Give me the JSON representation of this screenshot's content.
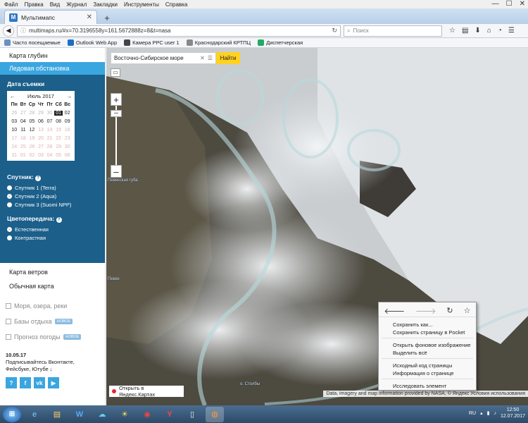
{
  "menu": [
    "Файл",
    "Правка",
    "Вид",
    "Журнал",
    "Закладки",
    "Инструменты",
    "Справка"
  ],
  "tab": {
    "title": "Мультимапс",
    "favicon": "M"
  },
  "url": "multimaps.ru/#x=70.3196558y=161.5672888z=8&t=nasa",
  "search_placeholder": "Поиск",
  "bookmarks": [
    "Часто посещаемые",
    "Outlook Web App",
    "Камера РРС user 1",
    "Краснодарский КРТПЦ",
    "Диспетчерская"
  ],
  "sidebar": {
    "depth_map": "Карта глубин",
    "ice": "Ледовая обстановка",
    "date_label": "Дата съемки",
    "calendar": {
      "month": "Июль 2017",
      "dow": [
        "Пн",
        "Вт",
        "Ср",
        "Чт",
        "Пт",
        "Сб",
        "Вс"
      ],
      "days": [
        [
          "26",
          "dim"
        ],
        [
          "27",
          "dim"
        ],
        [
          "28",
          "dim"
        ],
        [
          "29",
          "dim"
        ],
        [
          "30",
          "dim"
        ],
        [
          "01",
          "sel"
        ],
        [
          "02",
          ""
        ],
        [
          "03",
          ""
        ],
        [
          "04",
          ""
        ],
        [
          "05",
          ""
        ],
        [
          "06",
          ""
        ],
        [
          "07",
          ""
        ],
        [
          "08",
          ""
        ],
        [
          "09",
          ""
        ],
        [
          "10",
          ""
        ],
        [
          "11",
          ""
        ],
        [
          "12",
          ""
        ],
        [
          "13",
          "disabled"
        ],
        [
          "14",
          "disabled"
        ],
        [
          "15",
          "disabled"
        ],
        [
          "16",
          "disabled"
        ],
        [
          "17",
          "disabled"
        ],
        [
          "18",
          "disabled"
        ],
        [
          "19",
          "disabled"
        ],
        [
          "20",
          "disabled"
        ],
        [
          "21",
          "disabled"
        ],
        [
          "22",
          "disabled"
        ],
        [
          "23",
          "disabled"
        ],
        [
          "24",
          "disabled"
        ],
        [
          "25",
          "disabled"
        ],
        [
          "26",
          "disabled"
        ],
        [
          "27",
          "disabled"
        ],
        [
          "28",
          "disabled"
        ],
        [
          "29",
          "disabled"
        ],
        [
          "30",
          "disabled"
        ],
        [
          "31",
          "disabled"
        ],
        [
          "01",
          "disabled"
        ],
        [
          "02",
          "disabled"
        ],
        [
          "03",
          "disabled"
        ],
        [
          "04",
          "disabled"
        ],
        [
          "05",
          "disabled"
        ],
        [
          "06",
          "disabled"
        ]
      ]
    },
    "satellite_label": "Спутник:",
    "satellites": [
      "Спутник 1 (Terra)",
      "Спутник 2 (Aqua)",
      "Спутник 3 (Suomi NPP)"
    ],
    "color_label": "Цветопередача:",
    "colors": [
      "Естественная",
      "Контрастная"
    ],
    "wind_map": "Карта ветров",
    "normal_map": "Обычная карта",
    "layers": [
      {
        "label": "Моря, озера, реки",
        "badge": ""
      },
      {
        "label": "Базы отдыха",
        "badge": "НОВОЕ"
      },
      {
        "label": "Прогноз погоды",
        "badge": "НОВОЕ"
      }
    ],
    "news_date": "10.05.17",
    "news_text_1": "Подписывайтесь Вконтакте,",
    "news_text_2": "Фейсбуке, Ютубе ↓",
    "social": [
      "?",
      "f",
      "vk",
      "▶"
    ]
  },
  "map": {
    "search_value": "Восточно-Сибирское море",
    "find": "Найти",
    "open_yandex": "Открыть в Яндекс.Картах",
    "attribution": "Data, imagery and map information provided by NASA, © Яндекс Условия использования",
    "labels": [
      "Певекская губа",
      "Певек",
      "о. Столбы"
    ]
  },
  "context_menu": {
    "items": [
      "Сохранить как...",
      "Сохранить страницу в Pocket",
      "Открыть фоновое изображение",
      "Выделить всё",
      "Исходный код страницы",
      "Информация о странице",
      "Исследовать элемент"
    ]
  },
  "tray": {
    "lang": "RU",
    "time": "12:50",
    "date": "12.07.2017"
  },
  "colors": {
    "accent": "#3aa6e0",
    "panel": "#1b5f8a",
    "find": "#ffd21f"
  }
}
